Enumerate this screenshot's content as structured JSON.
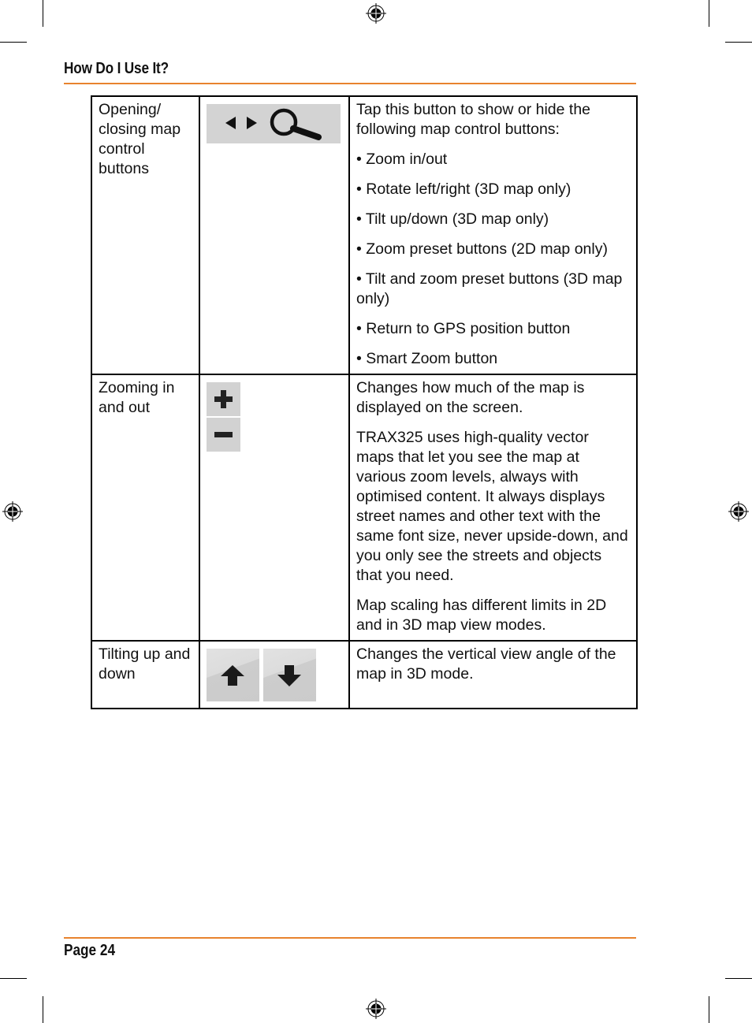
{
  "header": {
    "running_head": "How Do I Use It?",
    "accent_color": "#e8832e"
  },
  "table": {
    "rows": [
      {
        "name": "Opening/ closing map control buttons",
        "icons": [
          "triangle-left-icon",
          "triangle-right-icon",
          "magnifier-icon"
        ],
        "description": [
          "Tap this button to show or hide the following map control buttons:",
          "• Zoom in/out",
          "• Rotate left/right (3D map only)",
          "• Tilt up/down (3D map only)",
          "• Zoom preset buttons (2D map only)",
          "• Tilt and zoom preset buttons (3D map only)",
          "• Return to GPS position button",
          "• Smart Zoom button"
        ]
      },
      {
        "name": "Zooming in and out",
        "icons": [
          "plus-icon",
          "minus-icon"
        ],
        "description": [
          "Changes how much of the map is displayed on the screen.",
          "TRAX325 uses high-quality vector maps that let you see the map at various zoom levels, always with optimised content. It always displays street names and other text with the same font size, never upside-down, and you only see the streets and objects that you need.",
          "Map scaling has different limits in 2D and in 3D map view modes."
        ]
      },
      {
        "name": "Tilting up and down",
        "icons": [
          "arrow-up-icon",
          "arrow-down-icon"
        ],
        "description": [
          "Changes the vertical view angle of the map in 3D mode."
        ]
      }
    ]
  },
  "footer": {
    "page_label": "Page 24"
  }
}
